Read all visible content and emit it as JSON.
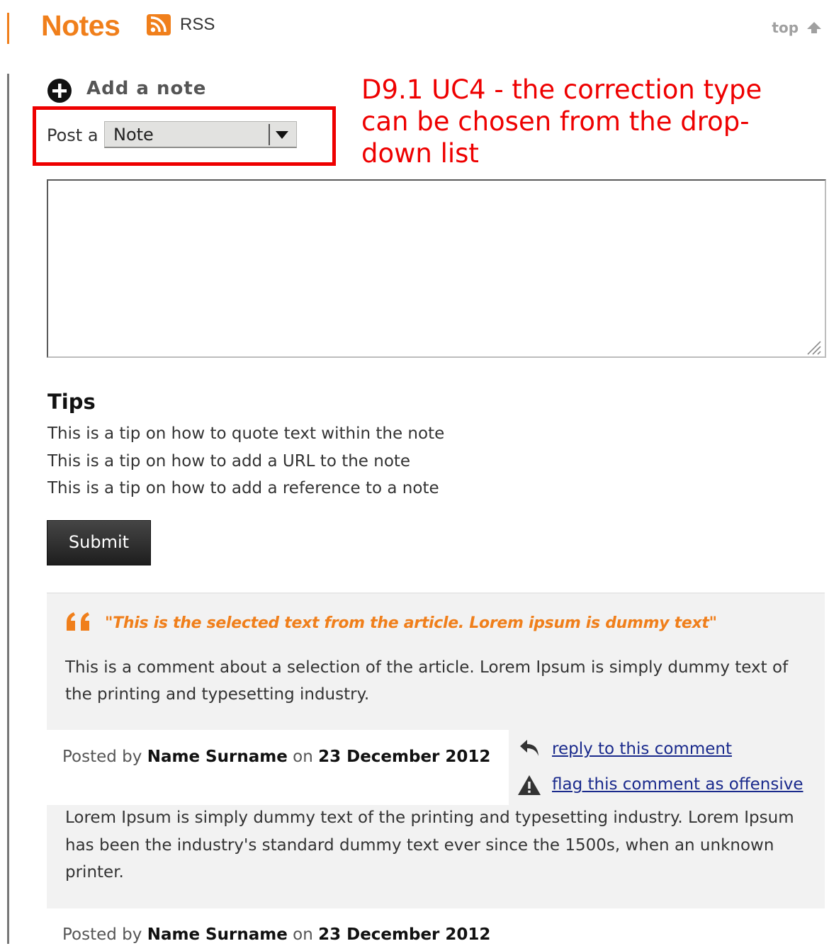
{
  "header": {
    "title": "Notes",
    "rss_label": "RSS",
    "top_label": "top",
    "accent_color": "#f07f1b",
    "icons": [
      "rss-icon",
      "arrow-up-icon"
    ]
  },
  "note_form": {
    "add_note_label": "Add a note",
    "post_a_label": "Post a",
    "type_select": {
      "selected": "Note"
    },
    "textarea_value": "",
    "tips_title": "Tips",
    "tips": [
      "This is a tip on how to quote text within the note",
      "This is a tip on how to add a URL to the note",
      "This is a tip on how to add a reference to a note"
    ],
    "submit_label": "Submit"
  },
  "annotation": {
    "text": "D9.1 UC4 - the correction type can be chosen from the drop-down list",
    "color": "#ee0000"
  },
  "comments": [
    {
      "quote": "\"This is the selected text from the article. Lorem ipsum is dummy text\"",
      "body": "This is a comment about a selection of the article. Lorem Ipsum is simply dummy text of the printing and typesetting industry.",
      "posted_by_prefix": "Posted by",
      "author": "Name Surname",
      "on_label": "on",
      "date": "23 December 2012",
      "reply_label": "reply to this comment",
      "flag_label": "flag this comment as offensive"
    },
    {
      "body": "Lorem Ipsum is simply dummy text of the printing and typesetting industry. Lorem Ipsum has been the industry's standard dummy text ever since the 1500s, when an unknown printer.",
      "posted_by_prefix": "Posted by",
      "author": "Name Surname",
      "on_label": "on",
      "date": "23 December 2012"
    }
  ]
}
